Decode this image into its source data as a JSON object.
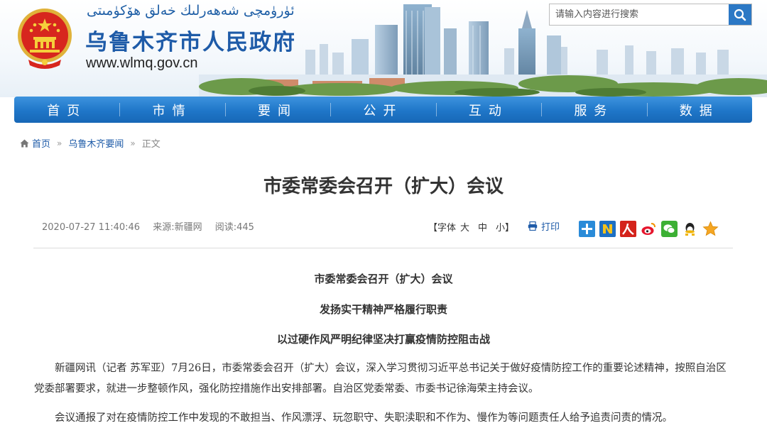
{
  "header": {
    "uyghur_title": "ئۈرۈمچى شەھەرلىك خەلق ھۆكۈمىتى",
    "site_title": "乌鲁木齐市人民政府",
    "site_url": "www.wlmq.gov.cn",
    "emblem_icon": "national-emblem-icon"
  },
  "search": {
    "placeholder": "请输入内容进行搜索",
    "button_icon": "search-icon"
  },
  "nav": {
    "items": [
      {
        "label": "首页"
      },
      {
        "label": "市情"
      },
      {
        "label": "要闻"
      },
      {
        "label": "公开"
      },
      {
        "label": "互动"
      },
      {
        "label": "服务"
      },
      {
        "label": "数据"
      }
    ]
  },
  "breadcrumb": {
    "home": "首页",
    "section": "乌鲁木齐要闻",
    "current": "正文",
    "separator": "»"
  },
  "article": {
    "title": "市委常委会召开（扩大）会议",
    "date": "2020-07-27 11:40:46",
    "source": "来源:新疆网",
    "views": "阅读:445",
    "font_size_label": "【字体",
    "font_large": "大",
    "font_medium": "中",
    "font_small": "小】",
    "print_label": "打印",
    "share_icons": [
      "plus-share-icon",
      "n-share-icon",
      "renren-icon",
      "weibo-icon",
      "wechat-icon",
      "qq-icon",
      "favorite-star-icon"
    ],
    "subheads": [
      "市委常委会召开（扩大）会议",
      "发扬实干精神严格履行职责",
      "以过硬作风严明纪律坚决打赢疫情防控阻击战"
    ],
    "paragraphs": [
      "新疆网讯（记者 苏军亚）7月26日，市委常委会召开（扩大）会议，深入学习贯彻习近平总书记关于做好疫情防控工作的重要论述精神，按照自治区党委部署要求，就进一步整顿作风，强化防控措施作出安排部署。自治区党委常委、市委书记徐海荣主持会议。",
      "会议通报了对在疫情防控工作中发现的不敢担当、作风漂浮、玩忽职守、失职渎职和不作为、慢作为等问题责任人给予追责问责的情况。"
    ]
  },
  "colors": {
    "brand_blue": "#1e5ba8",
    "nav_blue": "#1f76c8"
  }
}
